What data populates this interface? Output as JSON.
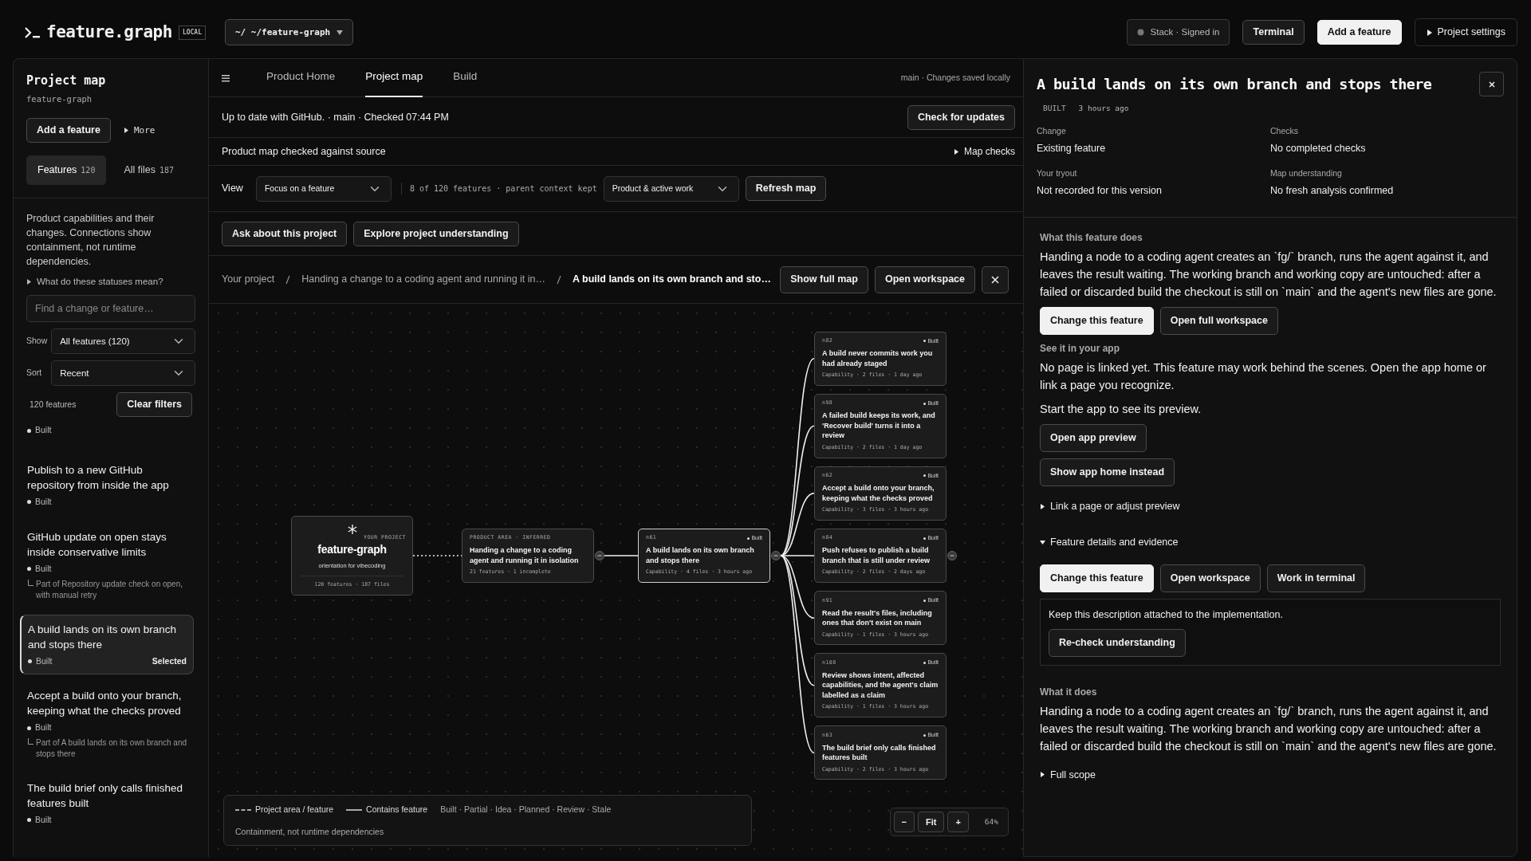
{
  "topbar": {
    "logo": "feature.graph",
    "badge": "LOCAL",
    "path_button": "~/ ~/feature-graph",
    "status_chip": "Stack · Signed in",
    "buttons": [
      {
        "label": "Terminal",
        "kind": "plain"
      },
      {
        "label": "Add a feature",
        "kind": "primary"
      },
      {
        "label": "Project settings",
        "kind": "disclosure",
        "expanded": false
      }
    ]
  },
  "sidebar": {
    "title": "Project map",
    "subtitle": "feature-graph",
    "add_button": "Add a feature",
    "more": {
      "label": "More",
      "expanded": false
    },
    "tabs": [
      {
        "label": "Features",
        "count": "120",
        "selected": true
      },
      {
        "label": "All files",
        "count": "187",
        "selected": false
      }
    ],
    "description": "Product capabilities and their changes. Connections show containment, not runtime dependencies.",
    "statuses_help": {
      "label": "What do these statuses mean?",
      "expanded": false
    },
    "search": {
      "placeholder": "Find a change or feature…"
    },
    "filters": [
      {
        "label": "Show",
        "value": "All features (120)"
      },
      {
        "label": "Sort",
        "value": "Recent"
      }
    ],
    "result_count": "120 features",
    "clear_button": "Clear filters",
    "features": [
      {
        "status": "Built",
        "selected": false
      },
      {
        "title": "Publish to a new GitHub repository from inside the app",
        "status": "Built",
        "selected": false
      },
      {
        "title": "GitHub update on open stays inside conservative limits",
        "status": "Built",
        "parent": "Part of Repository update check on open, with manual retry",
        "selected": false
      },
      {
        "title": "A build lands on its own branch and stops there",
        "status": "Built",
        "badge": "Selected",
        "selected": true
      },
      {
        "title": "Accept a build onto your branch, keeping what the checks proved",
        "status": "Built",
        "parent": "Part of A build lands on its own branch and stops there",
        "selected": false
      },
      {
        "title": "The build brief only calls finished features built",
        "status": "Built",
        "selected": false
      }
    ]
  },
  "main": {
    "tabs": [
      {
        "label": "Product Home",
        "selected": false
      },
      {
        "label": "Project map",
        "selected": true
      },
      {
        "label": "Build",
        "selected": false
      }
    ],
    "save_status": "main · Changes saved locally",
    "sync": {
      "text": "Up to date with GitHub. · main · Checked 07:44 PM",
      "button": "Check for updates"
    },
    "map_check": {
      "text": "Product map checked against source",
      "toggle": {
        "label": "Map checks",
        "expanded": false
      }
    },
    "view": {
      "label": "View",
      "mode": "Focus on a feature",
      "info": "8 of 120 features · parent context kept",
      "scope": "Product & active work",
      "button": "Refresh map"
    },
    "actions": [
      "Ask about this project",
      "Explore project understanding"
    ],
    "breadcrumb": [
      "Your project",
      "Handing a change to a coding agent and running it in…",
      "A build lands on its own branch and sto…"
    ],
    "breadcrumb_buttons": [
      "Show full map",
      "Open workspace"
    ],
    "graph": {
      "root": {
        "kind": "project",
        "eyebrow": "YOUR PROJECT",
        "title": "feature-graph",
        "subtitle": "orientation for vibecoding",
        "meta": "120 features · 187 files",
        "children": [
          {
            "kind": "area",
            "eyebrow": "PRODUCT AREA · INFERRED",
            "title": "Handing a change to a coding agent and running it in isolation",
            "meta": "21 features · 1 incomplete",
            "collapse_handle": true,
            "children": [
              {
                "kind": "feature",
                "id_label": "n61",
                "status": "Built",
                "title": "A build lands on its own branch and stops there",
                "meta": "Capability · 4 files · 3 hours ago",
                "selected": true,
                "collapse_handle": true,
                "children": [
                  {
                    "kind": "feature",
                    "id_label": "n82",
                    "status": "Built",
                    "title": "A build never commits work you had already staged",
                    "meta": "Capability · 2 files · 1 day ago",
                    "selected": false
                  },
                  {
                    "kind": "feature",
                    "id_label": "n98",
                    "status": "Built",
                    "title": "A failed build keeps its work, and 'Recover build' turns it into a review",
                    "meta": "Capability · 2 files · 1 day ago",
                    "selected": false
                  },
                  {
                    "kind": "feature",
                    "id_label": "n62",
                    "status": "Built",
                    "title": "Accept a build onto your branch, keeping what the checks proved",
                    "meta": "Capability · 3 files · 3 hours ago",
                    "selected": false
                  },
                  {
                    "kind": "feature",
                    "id_label": "n84",
                    "status": "Built",
                    "title": "Push refuses to publish a build branch that is still under review",
                    "meta": "Capability · 2 files · 2 days ago",
                    "selected": false,
                    "collapse_handle": true
                  },
                  {
                    "kind": "feature",
                    "id_label": "n91",
                    "status": "Built",
                    "title": "Read the result's files, including ones that don't exist on main",
                    "meta": "Capability · 1 files · 3 hours ago",
                    "selected": false
                  },
                  {
                    "kind": "feature",
                    "id_label": "n108",
                    "status": "Built",
                    "title": "Review shows intent, affected capabilities, and the agent's claim labelled as a claim",
                    "meta": "Capability · 1 files · 3 hours ago",
                    "selected": false
                  },
                  {
                    "kind": "feature",
                    "id_label": "n63",
                    "status": "Built",
                    "title": "The build brief only calls finished features built",
                    "meta": "Capability · 2 files · 3 hours ago",
                    "selected": false
                  }
                ]
              }
            ]
          }
        ]
      }
    },
    "legend": {
      "items": [
        {
          "kind": "dashed",
          "label": "Project area / feature"
        },
        {
          "kind": "solid",
          "label": "Contains feature"
        }
      ],
      "statuses": "Built · Partial · Idea · Planned · Review · Stale",
      "note": "Containment, not runtime dependencies"
    },
    "zoom": {
      "out": "−",
      "fit": "Fit",
      "in": "+",
      "level_text": "64%"
    }
  },
  "detail": {
    "title": "A build lands on its own branch and stops there",
    "status": "BUILT",
    "age": "3 hours ago",
    "facts": [
      {
        "label": "Change",
        "value": "Existing feature"
      },
      {
        "label": "Checks",
        "value": "No completed checks"
      },
      {
        "label": "Your tryout",
        "value": "Not recorded for this version"
      },
      {
        "label": "Map understanding",
        "value": "No fresh analysis confirmed"
      }
    ],
    "blocks": [
      {
        "kind": "heading",
        "text": "What this feature does"
      },
      {
        "kind": "paragraph",
        "text": "Handing a node to a coding agent creates an `fg/` branch, runs the agent against it, and leaves the result waiting. The working branch and working copy are untouched: after a failed or discarded build the checkout is still on `main` and the agent's new files are gone."
      },
      {
        "kind": "buttons",
        "buttons": [
          {
            "label": "Change this feature",
            "primary": true
          },
          {
            "label": "Open full workspace",
            "primary": false
          }
        ]
      },
      {
        "kind": "heading",
        "text": "See it in your app"
      },
      {
        "kind": "paragraph",
        "text": "No page is linked yet. This feature may work behind the scenes. Open the app home or link a page you recognize."
      },
      {
        "kind": "paragraph",
        "text": "Start the app to see its preview."
      },
      {
        "kind": "buttons",
        "buttons": [
          {
            "label": "Open app preview",
            "primary": false
          }
        ]
      },
      {
        "kind": "buttons",
        "buttons": [
          {
            "label": "Show app home instead",
            "primary": false
          }
        ]
      },
      {
        "kind": "disclosure",
        "label": "Link a page or adjust preview",
        "expanded": false
      },
      {
        "kind": "disclosure",
        "label": "Feature details and evidence",
        "expanded": true
      },
      {
        "kind": "buttons",
        "buttons": [
          {
            "label": "Change this feature",
            "primary": true
          },
          {
            "label": "Open workspace",
            "primary": false
          },
          {
            "label": "Work in terminal",
            "primary": false
          }
        ]
      },
      {
        "kind": "note_panel",
        "text": "Keep this description attached to the implementation.",
        "button": "Re-check understanding"
      },
      {
        "kind": "heading",
        "text": "What it does"
      },
      {
        "kind": "paragraph",
        "text": "Handing a node to a coding agent creates an `fg/` branch, runs the agent against it, and leaves the result waiting. The working branch and working copy are untouched: after a failed or discarded build the checkout is still on `main` and the agent's new files are gone."
      },
      {
        "kind": "disclosure",
        "label": "Full scope",
        "expanded": false
      }
    ]
  }
}
